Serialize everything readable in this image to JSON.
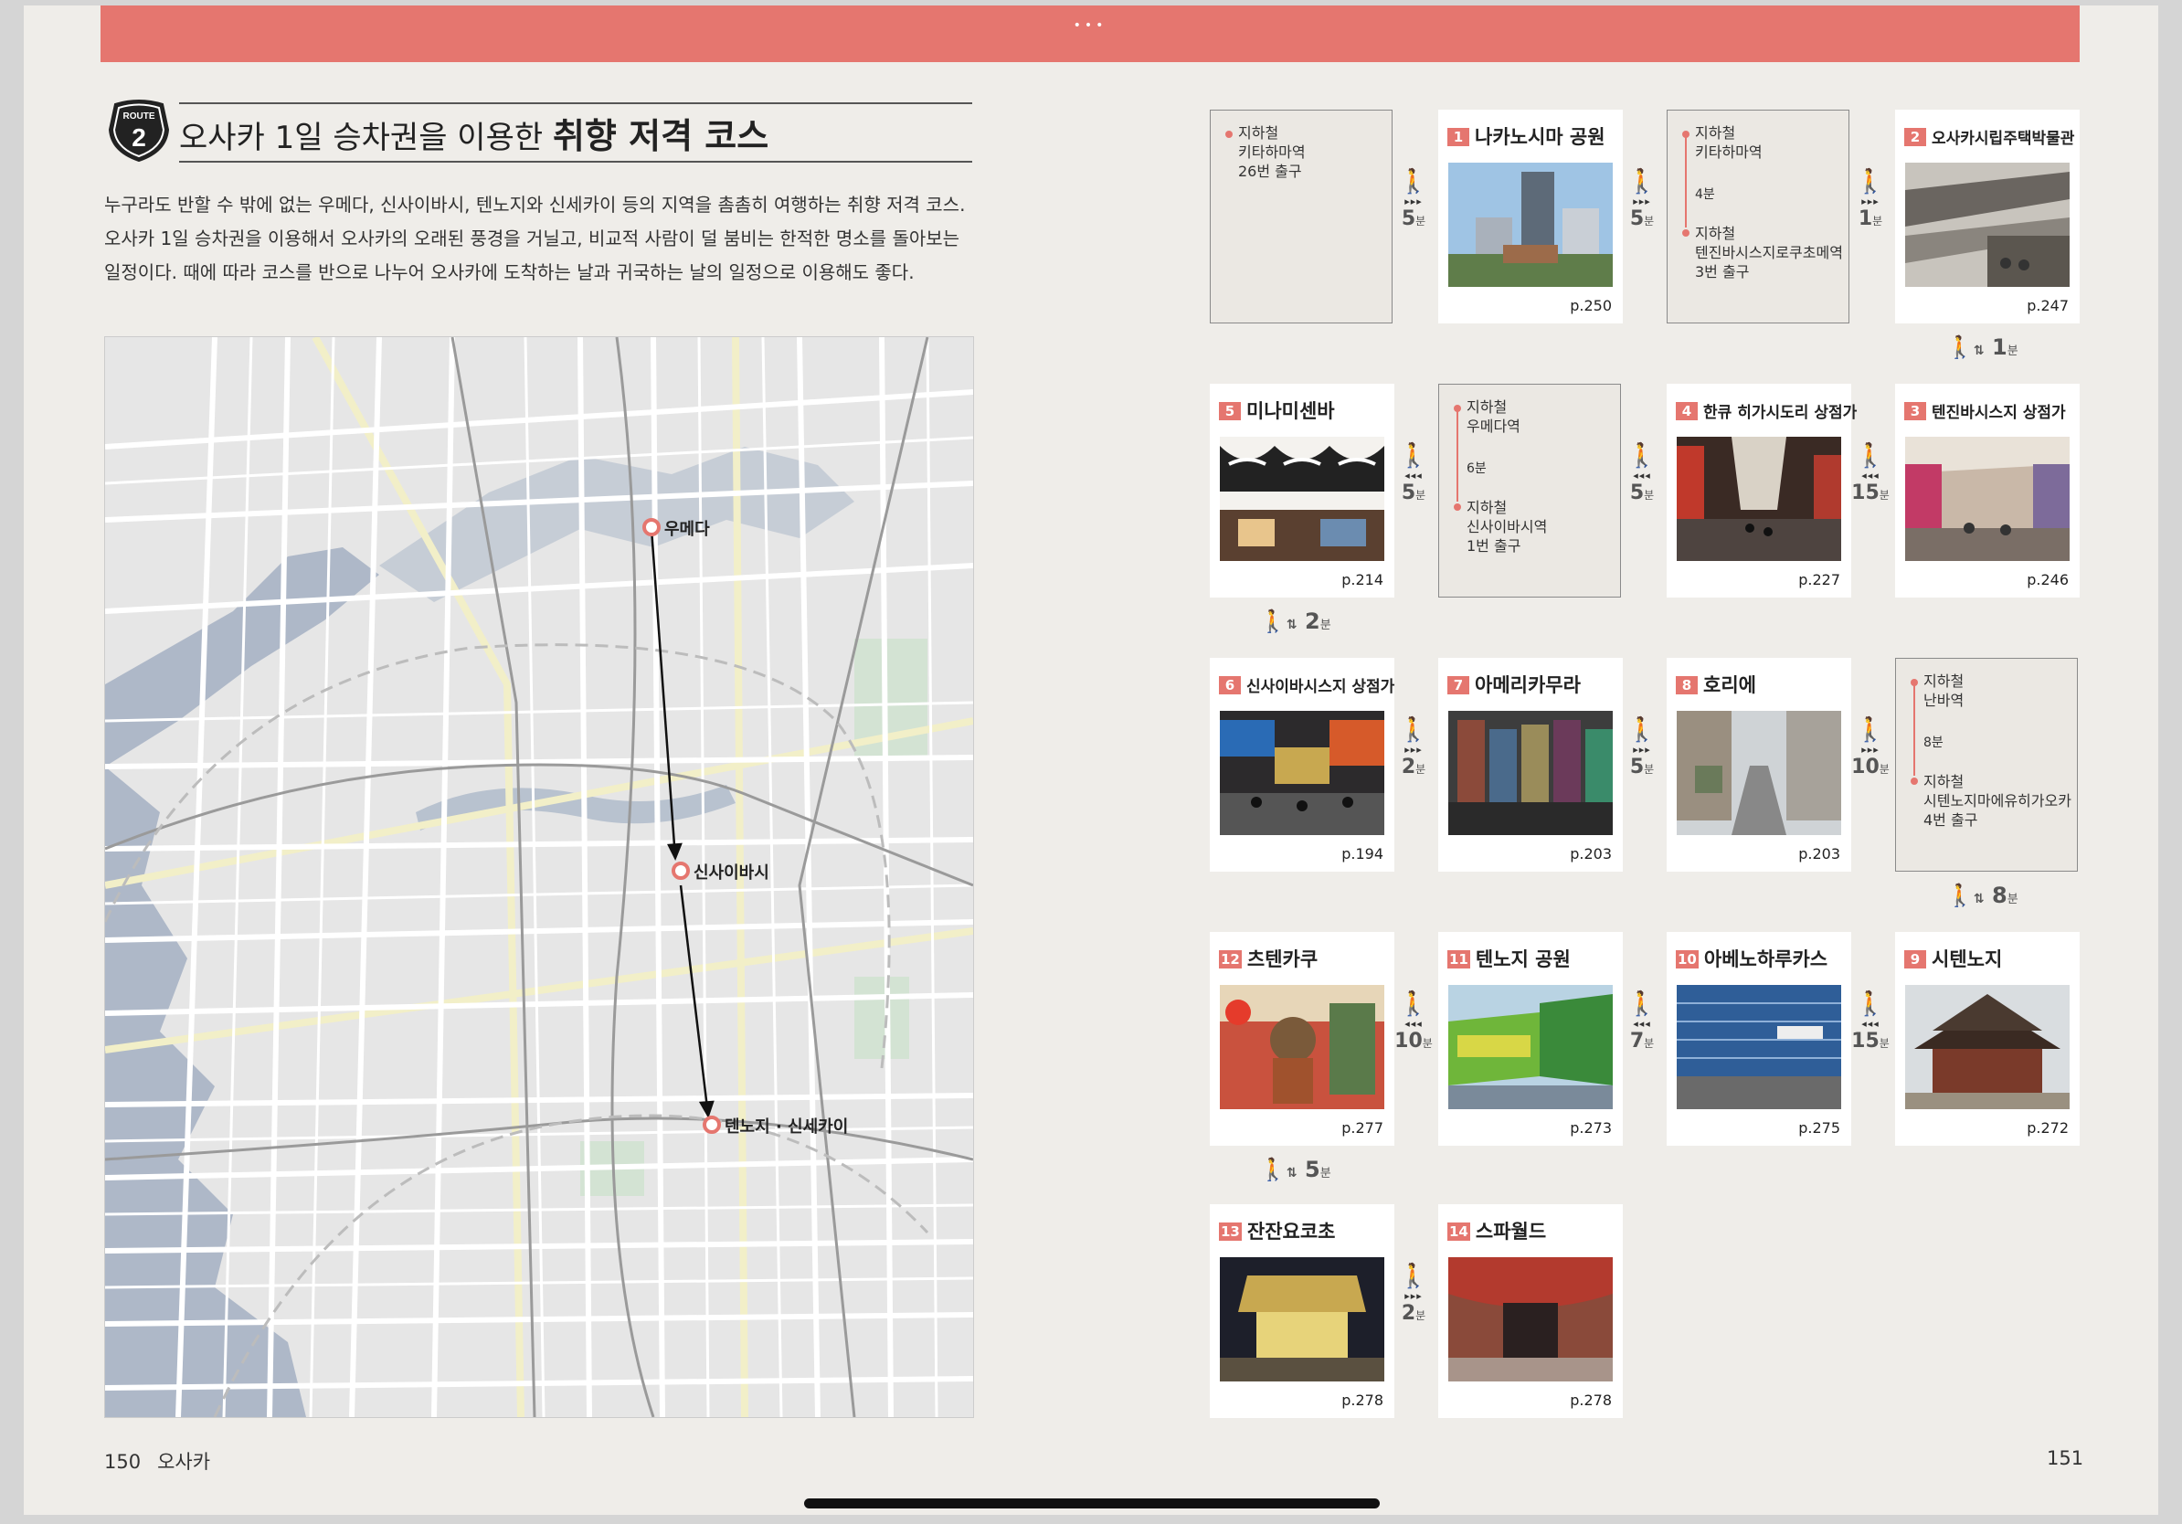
{
  "header": {
    "dots": "•••"
  },
  "route": {
    "badge_top": "ROUTE",
    "badge_num": "2"
  },
  "title": {
    "prefix": "오사카 1일 승차권을 이용한",
    "bold": "취향 저격 코스"
  },
  "intro": [
    "누구라도 반할 수 밖에 없는 우메다, 신사이바시, 텐노지와 신세카이 등의 지역을 촘촘히 여행하는 취향 저격 코스.",
    "오사카 1일 승차권을 이용해서 오사카의 오래된 풍경을 거닐고, 비교적 사람이 덜 붐비는 한적한 명소를 돌아보는",
    "일정이다. 때에 따라 코스를 반으로 나누어 오사카에 도착하는 날과 귀국하는 날의 일정으로 이용해도 좋다."
  ],
  "map": {
    "pins": [
      "우메다",
      "신사이바시",
      "텐노지 · 신세카이"
    ]
  },
  "footer": {
    "left_num": "150",
    "left_section": "오사카",
    "right_num": "151"
  },
  "stations": [
    {
      "lines": [
        "지하철",
        "키타하마역",
        "26번 출구"
      ]
    },
    {
      "from": [
        "지하철",
        "키타하마역"
      ],
      "mins": "4분",
      "to": [
        "지하철",
        "텐진바시스지로쿠초메역",
        "3번 출구"
      ]
    },
    {
      "from": [
        "지하철",
        "우메다역"
      ],
      "mins": "6분",
      "to": [
        "지하철",
        "신사이바시역",
        "1번 출구"
      ]
    },
    {
      "from": [
        "지하철",
        "난바역"
      ],
      "mins": "8분",
      "to": [
        "지하철",
        "시텐노지마에유히가오카",
        "4번 출구"
      ]
    }
  ],
  "cards": [
    {
      "num": "1",
      "name": "나카노시마 공원",
      "page": "p.250"
    },
    {
      "num": "2",
      "name": "오사카시립주택박물관",
      "page": "p.247"
    },
    {
      "num": "3",
      "name": "텐진바시스지 상점가",
      "page": "p.246"
    },
    {
      "num": "4",
      "name": "한큐 히가시도리 상점가",
      "page": "p.227"
    },
    {
      "num": "5",
      "name": "미나미센바",
      "page": "p.214"
    },
    {
      "num": "6",
      "name": "신사이바시스지 상점가",
      "page": "p.194"
    },
    {
      "num": "7",
      "name": "아메리카무라",
      "page": "p.203"
    },
    {
      "num": "8",
      "name": "호리에",
      "page": "p.203"
    },
    {
      "num": "9",
      "name": "시텐노지",
      "page": "p.272"
    },
    {
      "num": "10",
      "name": "아베노하루카스",
      "page": "p.275"
    },
    {
      "num": "11",
      "name": "텐노지 공원",
      "page": "p.273"
    },
    {
      "num": "12",
      "name": "츠텐카쿠",
      "page": "p.277"
    },
    {
      "num": "13",
      "name": "잔잔요코초",
      "page": "p.278"
    },
    {
      "num": "14",
      "name": "스파월드",
      "page": "p.278"
    }
  ],
  "walks": {
    "r1a": {
      "arrows": "▸▸▸",
      "t": "5",
      "u": "분"
    },
    "r1b": {
      "arrows": "▸▸▸",
      "t": "5",
      "u": "분"
    },
    "r1c": {
      "arrows": "▸▸▸",
      "t": "1",
      "u": "분"
    },
    "r2a": {
      "arrows": "◂◂◂",
      "t": "5",
      "u": "분"
    },
    "r2b": {
      "arrows": "◂◂◂",
      "t": "5",
      "u": "분"
    },
    "r2c": {
      "arrows": "◂◂◂",
      "t": "15",
      "u": "분"
    },
    "r3a": {
      "arrows": "▸▸▸",
      "t": "2",
      "u": "분"
    },
    "r3b": {
      "arrows": "▸▸▸",
      "t": "5",
      "u": "분"
    },
    "r3c": {
      "arrows": "▸▸▸",
      "t": "10",
      "u": "분"
    },
    "r4a": {
      "arrows": "◂◂◂",
      "t": "10",
      "u": "분"
    },
    "r4b": {
      "arrows": "◂◂◂",
      "t": "7",
      "u": "분"
    },
    "r4c": {
      "arrows": "◂◂◂",
      "t": "15",
      "u": "분"
    },
    "r5a": {
      "arrows": "▸▸▸",
      "t": "2",
      "u": "분"
    }
  },
  "vwalks": {
    "v1": {
      "t": "1",
      "u": "분"
    },
    "v2": {
      "t": "2",
      "u": "분"
    },
    "v3": {
      "t": "8",
      "u": "분"
    },
    "v4": {
      "t": "5",
      "u": "분"
    }
  }
}
